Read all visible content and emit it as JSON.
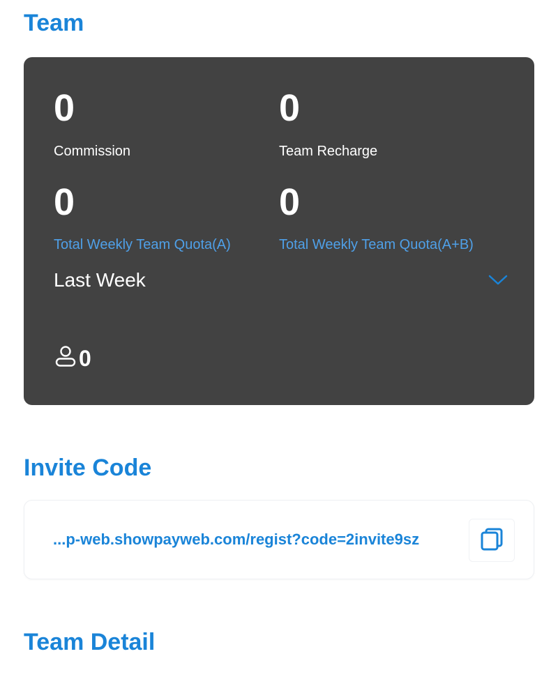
{
  "team": {
    "title": "Team",
    "commission": {
      "value": "0",
      "label": "Commission"
    },
    "team_recharge": {
      "value": "0",
      "label": "Team Recharge"
    },
    "weekly_quota_a": {
      "value": "0",
      "label": "Total Weekly Team Quota(A)"
    },
    "weekly_quota_ab": {
      "value": "0",
      "label": "Total Weekly Team Quota(A+B)"
    },
    "period": {
      "selected": "Last Week",
      "icon": "chevron-down-icon"
    },
    "members": {
      "icon": "user-icon",
      "count": "0"
    }
  },
  "invite": {
    "title": "Invite Code",
    "link": "...p-web.showpayweb.com/regist?code=2invite9sz",
    "copy_icon": "copy-icon"
  },
  "team_detail": {
    "title": "Team Detail"
  },
  "colors": {
    "accent": "#1a84d8",
    "card_bg": "#424242",
    "label_blue": "#4fa0e8",
    "white": "#ffffff"
  }
}
